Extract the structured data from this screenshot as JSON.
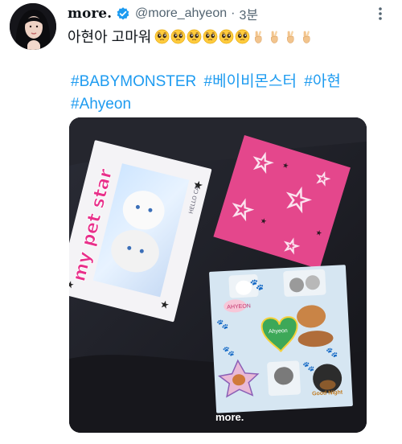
{
  "tweet": {
    "display_name": "more.",
    "handle": "@more_ahyeon",
    "separator": "·",
    "time": "3분",
    "text": "아현아 고마워",
    "emojis": {
      "pleading_count": 6,
      "crossed_fingers_count": 4
    },
    "hashtags": [
      "#BABYMONSTER",
      "#베이비몬스터",
      "#아현",
      "#Ahyeon"
    ],
    "link_color": "#1d9bf0",
    "verified_color": "#1d9bf0"
  },
  "media": {
    "sticker_left_text": "my pet star",
    "small_text_left": "HELLO CAT",
    "sheet_label_top": "AHYEON",
    "sheet_label_heart": "Ahyeon",
    "sheet_label_right": "Good Night",
    "watermark": "more."
  }
}
